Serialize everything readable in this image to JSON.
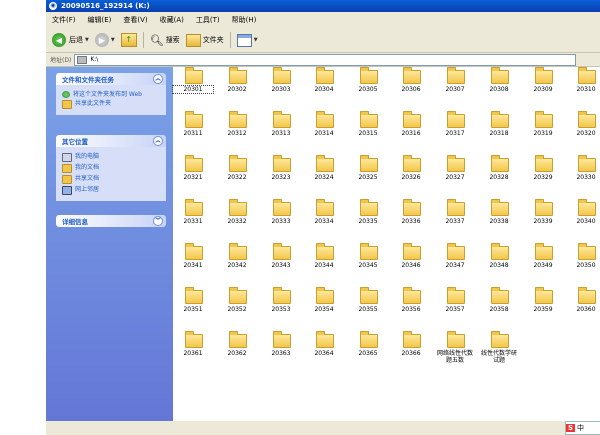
{
  "window": {
    "title": "20090516_192914 (K:)"
  },
  "menu": [
    "文件(F)",
    "编辑(E)",
    "查看(V)",
    "收藏(A)",
    "工具(T)",
    "帮助(H)"
  ],
  "toolbar": {
    "back": "后退",
    "search": "搜索",
    "folders": "文件夹"
  },
  "address": {
    "label": "地址(D)",
    "value": "K:\\"
  },
  "sidebar": {
    "file_tasks": {
      "title": "文件和文件夹任务",
      "items": [
        "将这个文件夹发布到 Web",
        "共享此文件夹"
      ]
    },
    "other_places": {
      "title": "其它位置",
      "items": [
        "我的电脑",
        "我的文档",
        "共享文档",
        "网上邻居"
      ]
    },
    "details": {
      "title": "详细信息"
    }
  },
  "folders": [
    "20301",
    "20302",
    "20303",
    "20304",
    "20305",
    "20306",
    "20307",
    "20308",
    "20309",
    "20310",
    "20311",
    "20312",
    "20313",
    "20314",
    "20315",
    "20316",
    "20317",
    "20318",
    "20319",
    "20320",
    "20321",
    "20322",
    "20323",
    "20324",
    "20325",
    "20326",
    "20327",
    "20328",
    "20329",
    "20330",
    "20331",
    "20332",
    "20333",
    "20334",
    "20335",
    "20336",
    "20337",
    "20338",
    "20339",
    "20340",
    "20341",
    "20342",
    "20343",
    "20344",
    "20345",
    "20346",
    "20347",
    "20348",
    "20349",
    "20350",
    "20351",
    "20352",
    "20353",
    "20354",
    "20355",
    "20356",
    "20357",
    "20358",
    "20359",
    "20360",
    "20361",
    "20362",
    "20363",
    "20364",
    "20365",
    "20366",
    "网络线性代数题五数",
    "线性代数学研试题"
  ],
  "ime": {
    "logo": "S",
    "mode": "中"
  }
}
